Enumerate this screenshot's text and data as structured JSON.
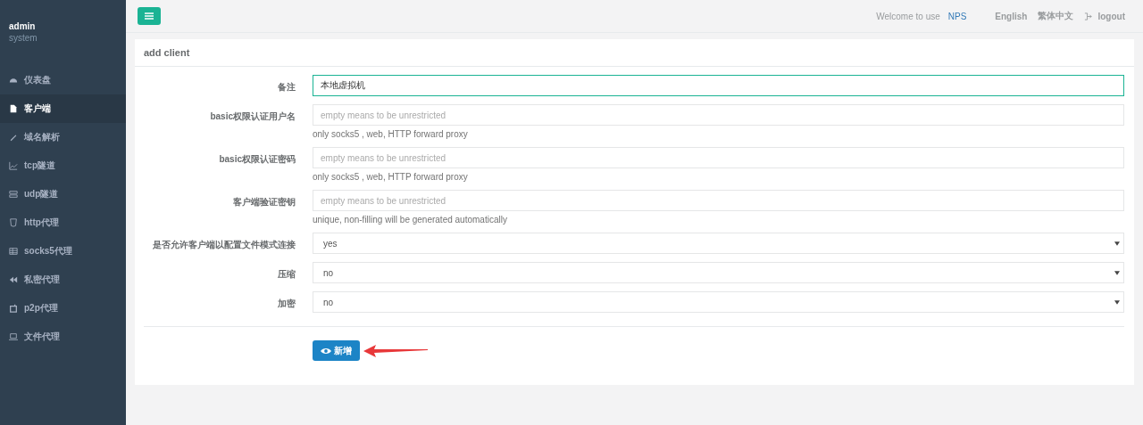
{
  "sidebar": {
    "user": {
      "name": "admin",
      "role": "system"
    },
    "items": [
      {
        "label": "仪表盘",
        "selected": false
      },
      {
        "label": "客户端",
        "selected": true
      },
      {
        "label": "域名解析",
        "selected": false
      },
      {
        "label": "tcp隧道",
        "selected": false
      },
      {
        "label": "udp隧道",
        "selected": false
      },
      {
        "label": "http代理",
        "selected": false
      },
      {
        "label": "socks5代理",
        "selected": false
      },
      {
        "label": "私密代理",
        "selected": false
      },
      {
        "label": "p2p代理",
        "selected": false
      },
      {
        "label": "文件代理",
        "selected": false
      }
    ]
  },
  "topbar": {
    "welcome": "Welcome to use",
    "brand": "NPS",
    "languages": [
      "English",
      "繁体中文"
    ],
    "logout": "logout"
  },
  "panel": {
    "title": "add client",
    "fields": [
      {
        "kind": "text",
        "label": "备注",
        "value": "本地虚拟机",
        "focused": true
      },
      {
        "kind": "text",
        "label": "basic权限认证用户名",
        "placeholder": "empty means to be unrestricted",
        "help": "only socks5 , web, HTTP forward proxy",
        "focused": false
      },
      {
        "kind": "text",
        "label": "basic权限认证密码",
        "placeholder": "empty means to be unrestricted",
        "help": "only socks5 , web, HTTP forward proxy",
        "focused": false
      },
      {
        "kind": "text",
        "label": "客户端验证密钥",
        "placeholder": "empty means to be unrestricted",
        "help": "unique, non-filling will be generated automatically",
        "focused": false
      },
      {
        "kind": "select",
        "label": "是否允许客户端以配置文件模式连接",
        "value": "yes"
      },
      {
        "kind": "select",
        "label": "压缩",
        "value": "no"
      },
      {
        "kind": "select",
        "label": "加密",
        "value": "no"
      }
    ],
    "submit": "新增"
  }
}
